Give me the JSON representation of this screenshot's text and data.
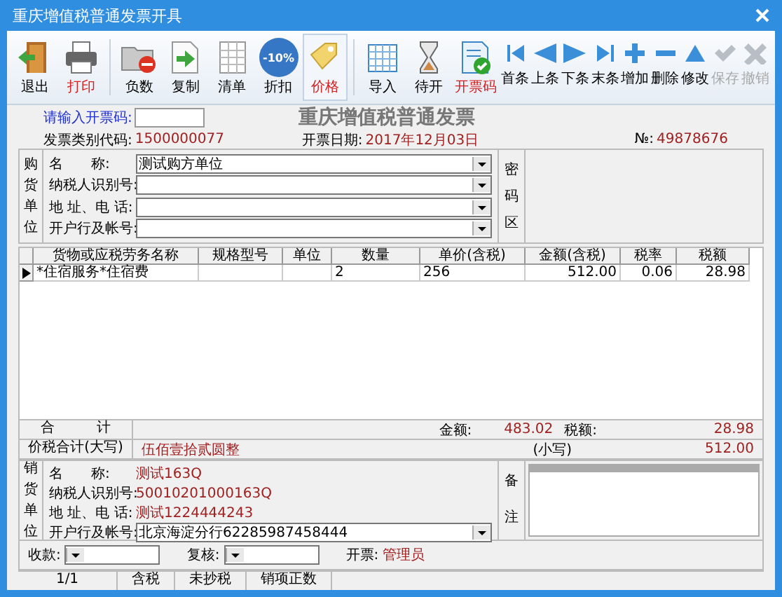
{
  "window": {
    "title": "重庆增值税普通发票开具"
  },
  "toolbar": {
    "groups": [
      [
        {
          "label": "退出",
          "accent": false,
          "pressed": false
        },
        {
          "label": "打印",
          "accent": true,
          "pressed": false
        }
      ],
      [
        {
          "label": "负数",
          "accent": false,
          "pressed": false
        },
        {
          "label": "复制",
          "accent": false,
          "pressed": false
        },
        {
          "label": "清单",
          "accent": false,
          "pressed": false
        },
        {
          "label": "折扣",
          "accent": false,
          "pressed": false,
          "icon_text": "-10%"
        },
        {
          "label": "价格",
          "accent": true,
          "pressed": true
        }
      ],
      [
        {
          "label": "导入",
          "accent": false,
          "pressed": false
        },
        {
          "label": "待开",
          "accent": false,
          "pressed": false
        },
        {
          "label": "开票码",
          "accent": true,
          "pressed": false
        }
      ]
    ],
    "nav": [
      {
        "label": "首条",
        "disabled": false
      },
      {
        "label": "上条",
        "disabled": false
      },
      {
        "label": "下条",
        "disabled": false
      },
      {
        "label": "末条",
        "disabled": false
      },
      {
        "label": "增加",
        "disabled": false
      },
      {
        "label": "删除",
        "disabled": false
      },
      {
        "label": "修改",
        "disabled": false
      },
      {
        "label": "保存",
        "disabled": true
      },
      {
        "label": "撤销",
        "disabled": true
      }
    ]
  },
  "header": {
    "code_prompt": "请输入开票码:",
    "invoice_title": "重庆增值税普通发票",
    "category_label": "发票类别代码:",
    "category_value": "1500000077",
    "date_label": "开票日期:",
    "date_value": "2017年12月03日",
    "no_label": "№:",
    "no_value": "49878676"
  },
  "buyer": {
    "title": "购货单位",
    "fields": [
      {
        "label": "名　　称:",
        "value": "测试购方单位"
      },
      {
        "label": "纳税人识别号:"
      },
      {
        "label": "地 址、电 话:"
      },
      {
        "label": "开户行及帐号:"
      }
    ],
    "cipher_label": "密码区"
  },
  "items": {
    "columns": [
      "货物或应税劳务名称",
      "规格型号",
      "单位",
      "数量",
      "单价(含税)",
      "金额(含税)",
      "税率",
      "税额"
    ],
    "rows": [
      {
        "selected": true,
        "cells": [
          "*住宿服务*住宿费",
          null,
          null,
          "2",
          "256",
          "512.00",
          "0.06",
          "28.98"
        ]
      }
    ]
  },
  "totals": {
    "label": "合　　　计",
    "amount_label": "金额:",
    "amount": "483.02",
    "tax_label": "税额:",
    "tax": "28.98"
  },
  "total_words": {
    "label": "价税合计(大写)",
    "words": "伍佰壹拾贰圆整",
    "small_label": "(小写)",
    "small": "512.00"
  },
  "seller": {
    "title": "销货单位",
    "fields": [
      {
        "label": "名　　称:",
        "value": "测试163Q",
        "kind": "text"
      },
      {
        "label": "纳税人识别号:",
        "value": "50010201000163Q",
        "kind": "text"
      },
      {
        "label": "地 址、电 话:",
        "value": "测试1224444243",
        "kind": "text"
      },
      {
        "label": "开户行及帐号:",
        "value": "北京海淀分行62285987458444",
        "kind": "combo"
      }
    ],
    "remarks_label": "备注"
  },
  "signers": [
    {
      "label": "收款:",
      "kind": "combo"
    },
    {
      "label": "复核:",
      "kind": "combo"
    },
    {
      "label": "开票:",
      "value": "管理员",
      "kind": "text"
    }
  ],
  "status_bar": [
    "1/1",
    "含税",
    "未抄税",
    "销项正数"
  ]
}
